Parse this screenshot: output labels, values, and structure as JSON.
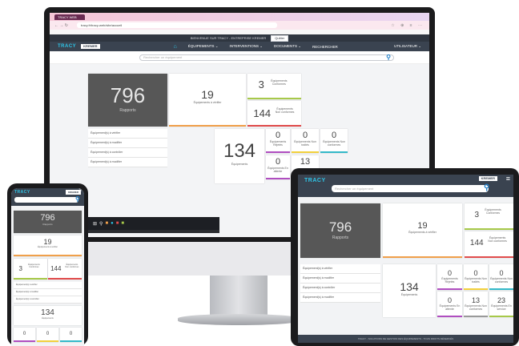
{
  "colors": {
    "accent": "#2ec5e8",
    "header": "#3a4350",
    "dark_tile": "#575757",
    "orange": "#f0a04b",
    "green": "#a7c94a",
    "red": "#e14c4c",
    "teal": "#33b9c9",
    "yellow": "#f2d03b",
    "purple": "#b04ec0",
    "search_icon": "#1e7ec8"
  },
  "browser": {
    "tab_title": "TRACY WEB",
    "url": "tracy.fr/tracy-web/site/accueil",
    "tools": "☆ ⊕ ≡ ⋯"
  },
  "app": {
    "logo": "TRACY",
    "brand": "KREMER",
    "topbar_text": "BIENVENUE SUR TRACY - ENTREPRISE KREMER",
    "topbar_pill": "Quitter",
    "menu": [
      "ÉQUIPEMENTS ⌄",
      "INTERVENTIONS ⌄",
      "DOCUMENTS ⌄",
      "RECHERCHER"
    ],
    "user_menu": "UTILISATEUR ⌄",
    "search_placeholder": "Rechercher un équipement",
    "home_icon": "home-icon",
    "search_icon": "search-icon"
  },
  "dashboard": {
    "reports_value": "796",
    "reports_label": "Rapports",
    "to_verify_value": "19",
    "to_verify_label": "Équipements à vérifier",
    "compliant_value": "3",
    "compliant_label": "Équipements Conformes",
    "non_compliant_value": "144",
    "non_compliant_label": "Équipements Non conformes",
    "equipments_value": "134",
    "equipments_label": "Équipements",
    "small": [
      {
        "value": "0",
        "label": "Équipements Rejetés"
      },
      {
        "value": "0",
        "label": "Équipements Non traités"
      },
      {
        "value": "0",
        "label": "Équipements Non conformes"
      },
      {
        "value": "0",
        "label": "Équipements En attente"
      },
      {
        "value": "13",
        "label": "Équipements Non conformes"
      },
      {
        "value": "23",
        "label": "Équipements En service"
      }
    ],
    "list": [
      "Équipement(s) à vérifier",
      "Équipement(s) à modifier",
      "Équipement(s) à contrôler",
      "Équipement(s) à modifier"
    ]
  },
  "tablet_footer": "TRACY - SOLUTIONS DE GESTION DES ÉQUIPEMENTS - TOUS DROITS RÉSERVÉS"
}
